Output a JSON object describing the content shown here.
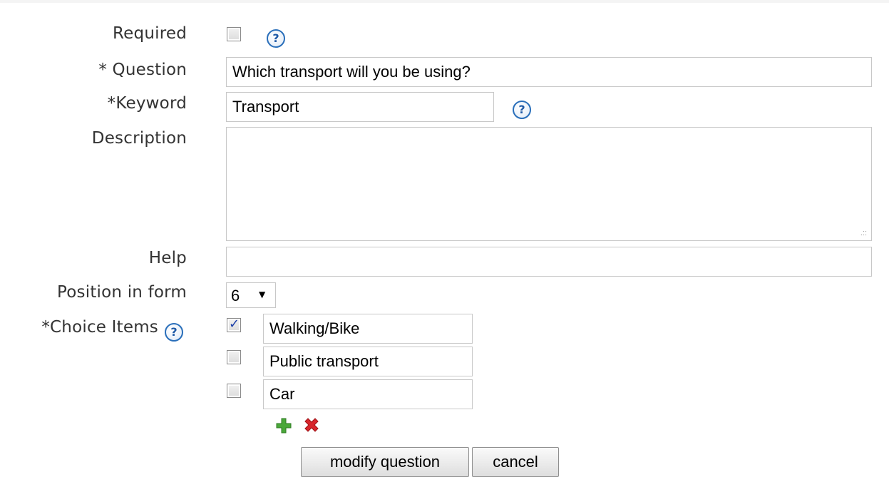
{
  "form": {
    "required_label": "Required",
    "question_label": "* Question",
    "question_value": "Which transport will you be using?",
    "keyword_label": "*Keyword",
    "keyword_value": "Transport",
    "description_label": "Description",
    "description_value": "",
    "help_label": "Help",
    "help_value": "",
    "position_label": "Position in form",
    "position_value": "6",
    "choice_items_label": "*Choice Items",
    "help_icon_glyph": "?",
    "choices": [
      {
        "label": "Walking/Bike",
        "checked": true
      },
      {
        "label": "Public transport",
        "checked": false
      },
      {
        "label": "Car",
        "checked": false
      }
    ],
    "add_icon": "plus-icon",
    "remove_icon": "x-icon",
    "modify_button_label": "modify question",
    "cancel_button_label": "cancel"
  },
  "colors": {
    "help_icon": "#2a6fba",
    "add_icon": "#4aa83a",
    "remove_icon": "#d8252b",
    "label_text": "#333333"
  }
}
